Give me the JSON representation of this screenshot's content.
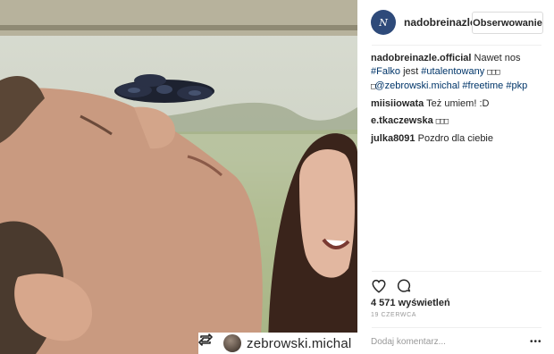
{
  "header": {
    "username": "nadobreinazle.",
    "avatar_text": "N",
    "follow_label": "Obserwowanie"
  },
  "photo": {
    "description_icon": "fidget-spinner-photo",
    "repost": {
      "icon": "repost-icon",
      "username": "zebrowski.michal"
    }
  },
  "post": {
    "user": "nadobreinazle.official",
    "text_1": "Nawet nos",
    "tag_1": "#Falko",
    "text_2": "jest",
    "tag_2": "#utalentowany",
    "boxes_1": "□□□",
    "boxes_2": "□",
    "mention": "@zebrowski.michal",
    "tag_3": "#freetime",
    "tag_4": "#pkp"
  },
  "comments": [
    {
      "user": "miisiiowata",
      "text": "Też umiem! :D"
    },
    {
      "user": "e.tkaczewska",
      "text": "□□□"
    },
    {
      "user": "julka8091",
      "text": "Pozdro dla ciebie"
    }
  ],
  "actions": {
    "like_icon": "heart-icon",
    "comment_icon": "comment-icon"
  },
  "views": "4 571 wyświetleń",
  "date": "19 CZERWCA",
  "comment_box": {
    "placeholder": "Dodaj komentarz...",
    "more": "•••"
  },
  "colors": {
    "link": "#003569",
    "border": "#dbdbdb",
    "muted": "#999999"
  }
}
